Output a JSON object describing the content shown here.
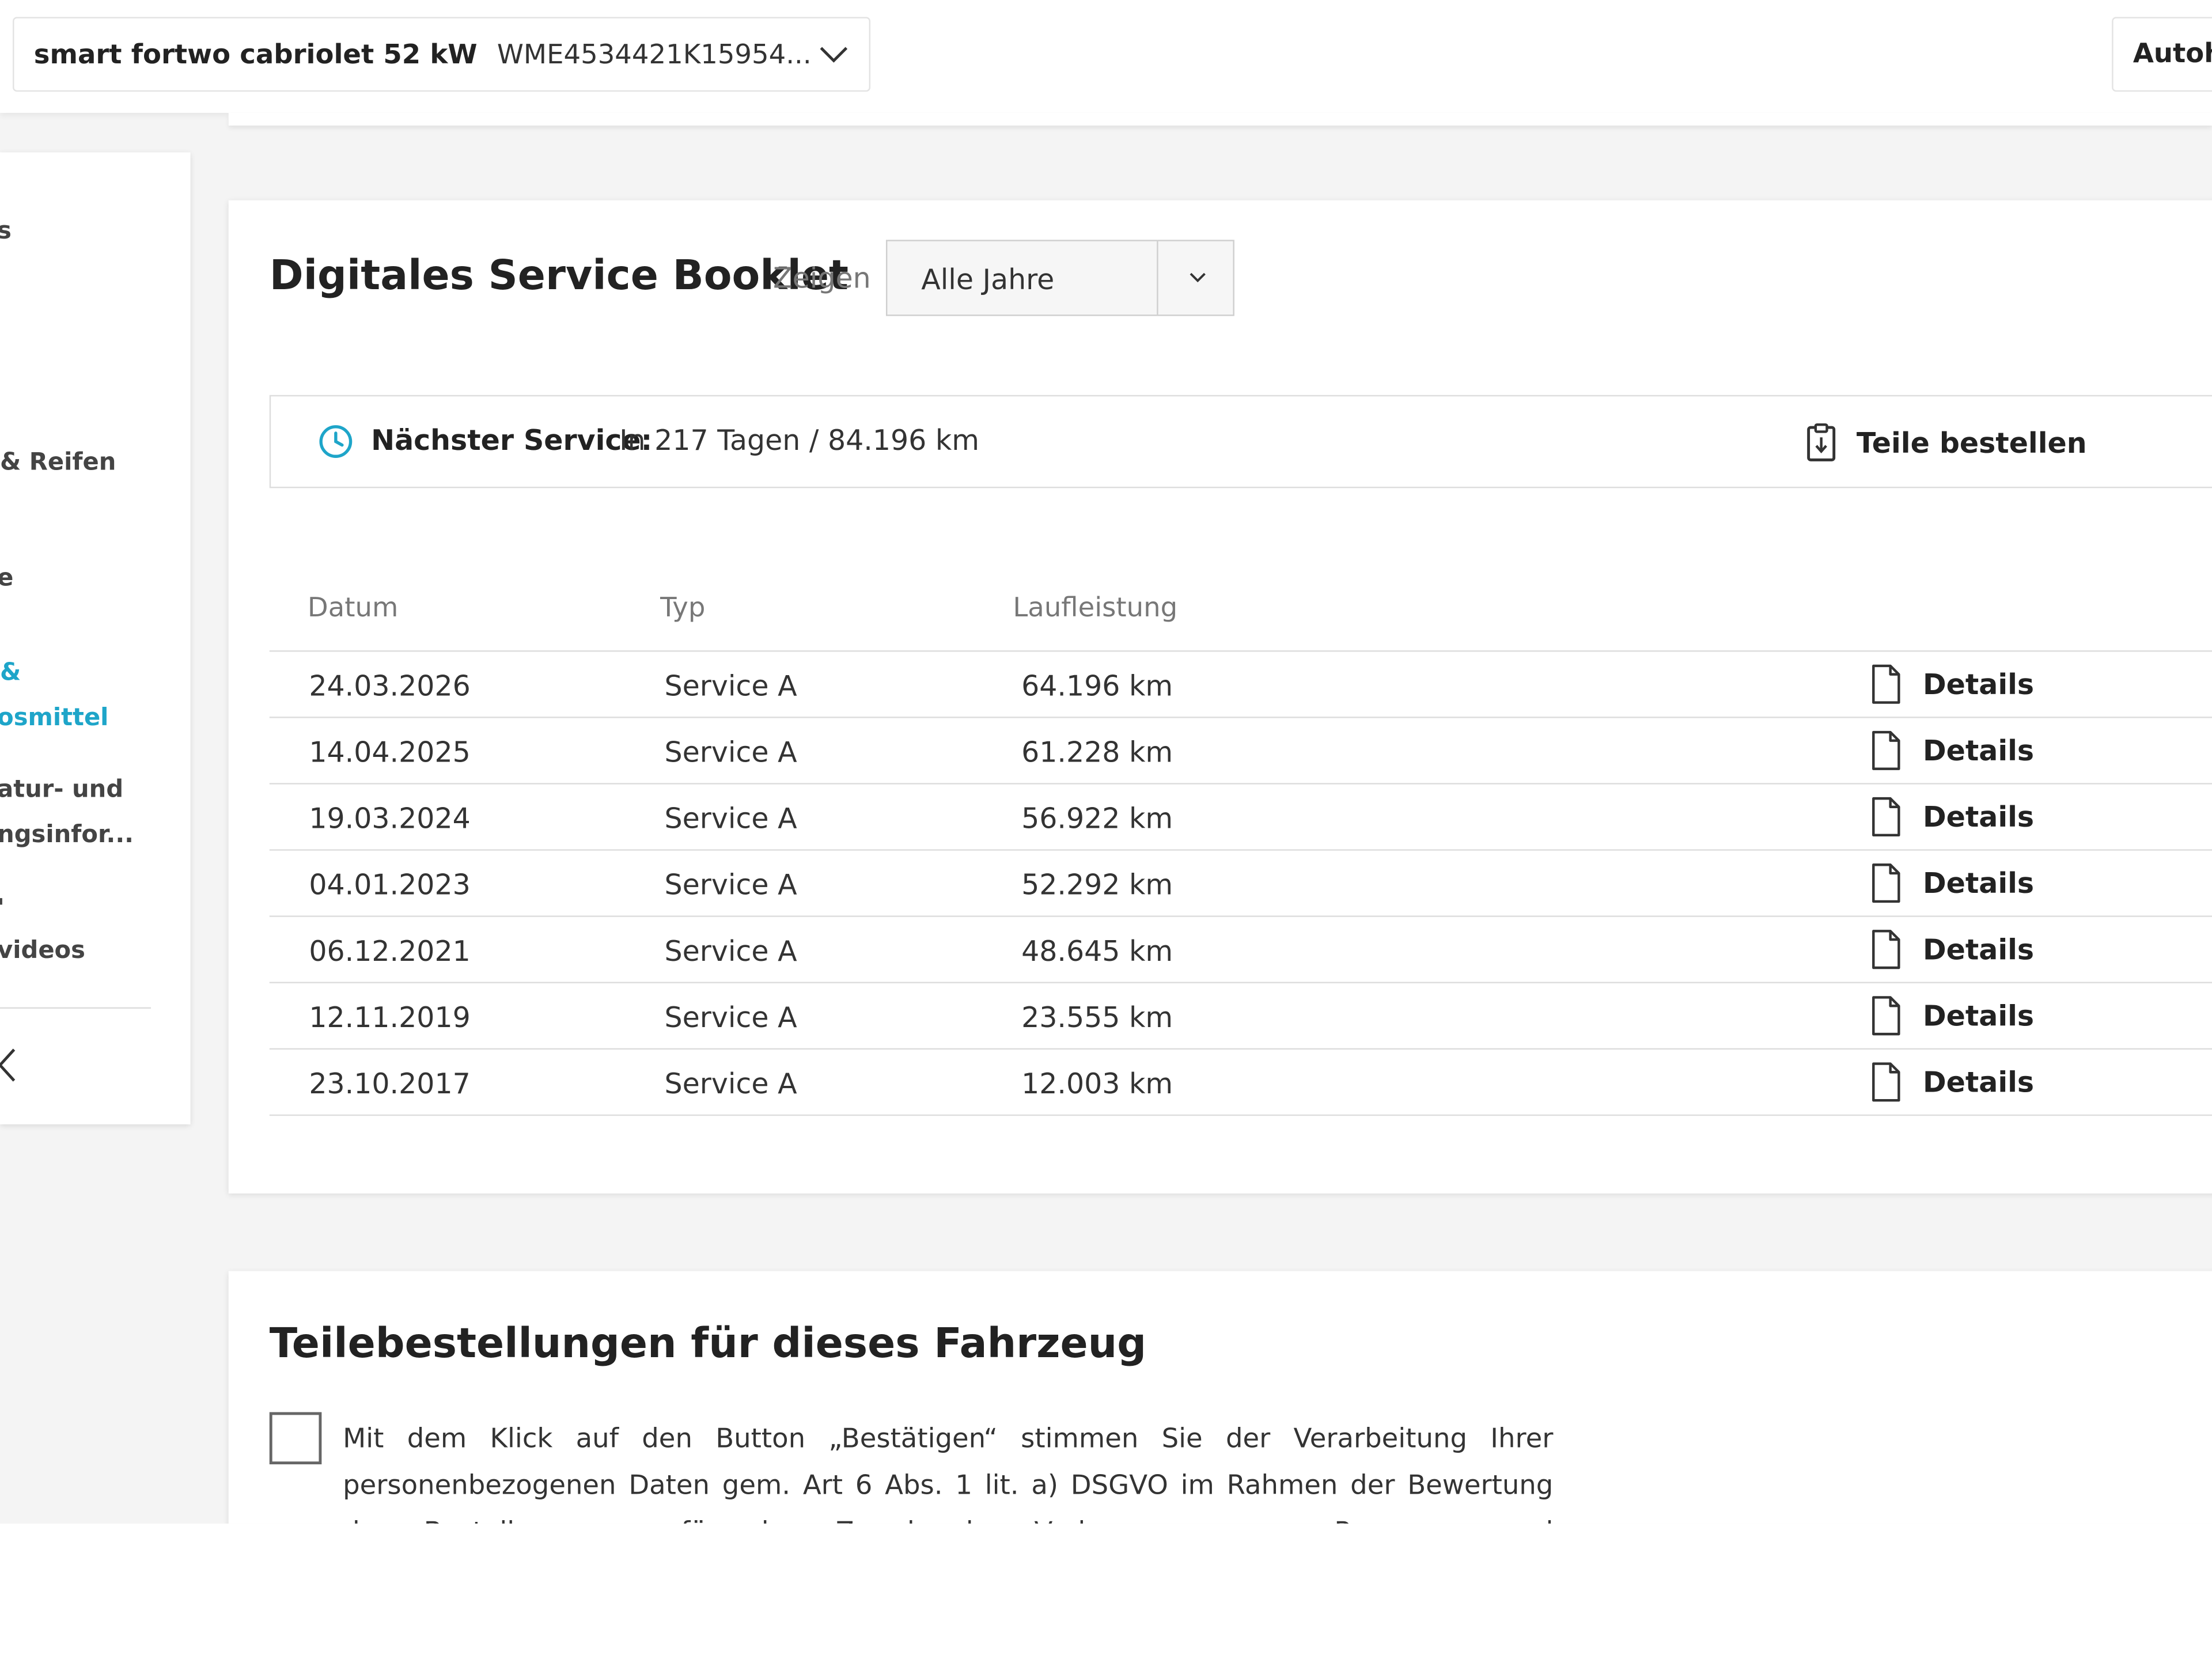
{
  "topbar": {
    "vehicle_model": "smart fortwo cabriolet 52 kW",
    "vehicle_vin": "WME4534421K15954...",
    "right_tab_label": "Autoh"
  },
  "sidebar": {
    "items": [
      {
        "label": "s"
      },
      {
        "label": "& Reifen"
      },
      {
        "label": "e"
      },
      {
        "label": "&"
      },
      {
        "label": "osmittel"
      },
      {
        "label": "atur- und"
      },
      {
        "label": "ngsinfor..."
      },
      {
        "label": "'"
      },
      {
        "label": "videos"
      }
    ]
  },
  "booklet": {
    "title": "Digitales Service Booklet",
    "filter_label": "Zeigen",
    "filter_value": "Alle Jahre",
    "next_service_label": "Nächster Service:",
    "next_service_value": "In 217 Tagen / 84.196 km",
    "order_parts_label": "Teile bestellen",
    "columns": {
      "date": "Datum",
      "type": "Typ",
      "mileage": "Laufleistung"
    },
    "details_label": "Details",
    "rows": [
      {
        "date": "24.03.2026",
        "type": "Service A",
        "mileage": "64.196 km"
      },
      {
        "date": "14.04.2025",
        "type": "Service A",
        "mileage": "61.228 km"
      },
      {
        "date": "19.03.2024",
        "type": "Service A",
        "mileage": "56.922 km"
      },
      {
        "date": "04.01.2023",
        "type": "Service A",
        "mileage": "52.292 km"
      },
      {
        "date": "06.12.2021",
        "type": "Service A",
        "mileage": "48.645 km"
      },
      {
        "date": "12.11.2019",
        "type": "Service A",
        "mileage": "23.555 km"
      },
      {
        "date": "23.10.2017",
        "type": "Service A",
        "mileage": "12.003 km"
      }
    ]
  },
  "orders": {
    "title": "Teilebestellungen für dieses Fahrzeug",
    "consent_text": "Mit dem Klick auf den Button „Bestätigen“ stimmen Sie der Verarbeitung Ihrer personenbezogenen Daten gem. Art 6 Abs. 1 lit. a) DSGVO im Rahmen der Bewertung des Bestellprozesses für den Zweck der Verbesserung von Prozessen und Servicleistungen zu."
  },
  "colors": {
    "accent": "#1ea5c9",
    "background": "#f4f4f4",
    "text": "#222222"
  },
  "icons": {
    "vehicle_select": "chevron-down-icon",
    "year_select": "chevron-down-icon",
    "next_service": "clock-icon",
    "order_parts": "clipboard-icon",
    "details": "document-icon",
    "sidebar_collapse": "chevron-left-icon"
  }
}
